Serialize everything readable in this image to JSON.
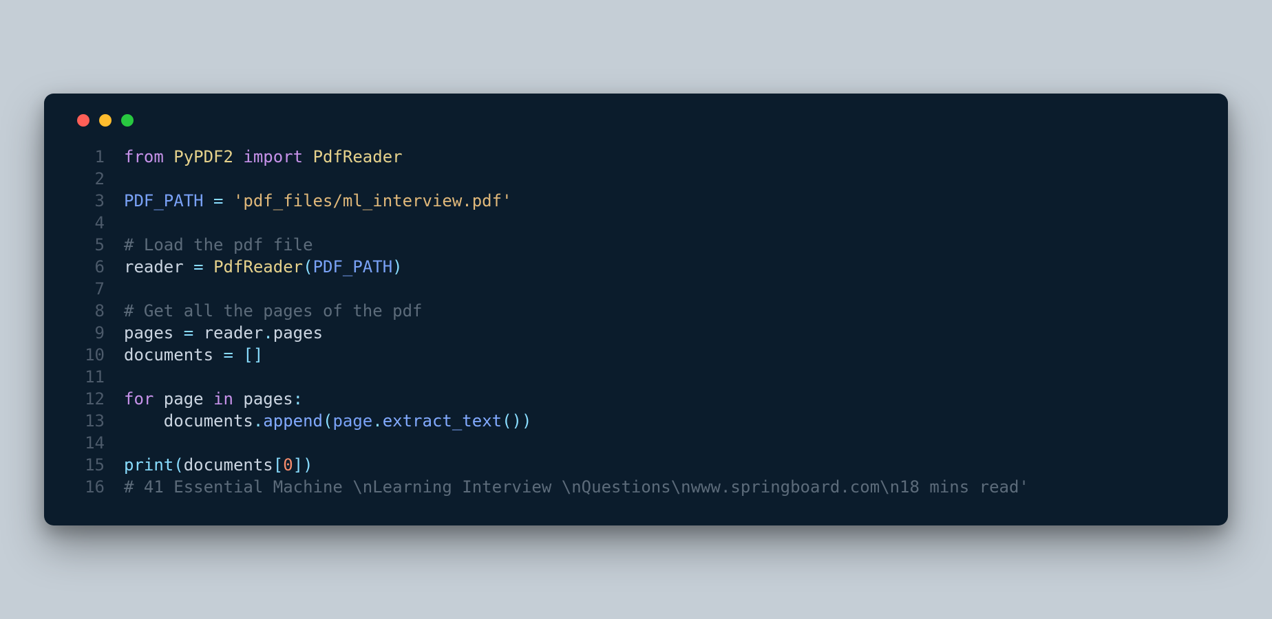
{
  "window": {
    "dots": [
      "red",
      "yellow",
      "green"
    ]
  },
  "code": {
    "lines": [
      {
        "n": "1",
        "tokens": [
          {
            "t": "from ",
            "c": "kw"
          },
          {
            "t": "PyPDF2 ",
            "c": "cls"
          },
          {
            "t": "import ",
            "c": "kw"
          },
          {
            "t": "PdfReader",
            "c": "cls"
          }
        ]
      },
      {
        "n": "2",
        "tokens": []
      },
      {
        "n": "3",
        "tokens": [
          {
            "t": "PDF_PATH ",
            "c": "const"
          },
          {
            "t": "= ",
            "c": "op"
          },
          {
            "t": "'pdf_files/ml_interview.pdf'",
            "c": "str"
          }
        ]
      },
      {
        "n": "4",
        "tokens": []
      },
      {
        "n": "5",
        "tokens": [
          {
            "t": "# Load the pdf file",
            "c": "cmt"
          }
        ]
      },
      {
        "n": "6",
        "tokens": [
          {
            "t": "reader ",
            "c": "var"
          },
          {
            "t": "= ",
            "c": "op"
          },
          {
            "t": "PdfReader",
            "c": "call"
          },
          {
            "t": "(",
            "c": "op"
          },
          {
            "t": "PDF_PATH",
            "c": "const"
          },
          {
            "t": ")",
            "c": "op"
          }
        ]
      },
      {
        "n": "7",
        "tokens": []
      },
      {
        "n": "8",
        "tokens": [
          {
            "t": "# Get all the pages of the pdf",
            "c": "cmt"
          }
        ]
      },
      {
        "n": "9",
        "tokens": [
          {
            "t": "pages ",
            "c": "var"
          },
          {
            "t": "= ",
            "c": "op"
          },
          {
            "t": "reader",
            "c": "var"
          },
          {
            "t": ".",
            "c": "op"
          },
          {
            "t": "pages",
            "c": "var"
          }
        ]
      },
      {
        "n": "10",
        "tokens": [
          {
            "t": "documents ",
            "c": "var"
          },
          {
            "t": "= ",
            "c": "op"
          },
          {
            "t": "[]",
            "c": "op"
          }
        ]
      },
      {
        "n": "11",
        "tokens": []
      },
      {
        "n": "12",
        "tokens": [
          {
            "t": "for ",
            "c": "kw"
          },
          {
            "t": "page ",
            "c": "var"
          },
          {
            "t": "in ",
            "c": "kw"
          },
          {
            "t": "pages",
            "c": "var"
          },
          {
            "t": ":",
            "c": "op"
          }
        ]
      },
      {
        "n": "13",
        "tokens": [
          {
            "t": "    ",
            "c": "var"
          },
          {
            "t": "documents",
            "c": "var"
          },
          {
            "t": ".",
            "c": "op"
          },
          {
            "t": "append",
            "c": "fn"
          },
          {
            "t": "(",
            "c": "op"
          },
          {
            "t": "page",
            "c": "param"
          },
          {
            "t": ".",
            "c": "op"
          },
          {
            "t": "extract_text",
            "c": "fn"
          },
          {
            "t": "())",
            "c": "op"
          }
        ]
      },
      {
        "n": "14",
        "tokens": []
      },
      {
        "n": "15",
        "tokens": [
          {
            "t": "print",
            "c": "builtin"
          },
          {
            "t": "(",
            "c": "op"
          },
          {
            "t": "documents",
            "c": "var"
          },
          {
            "t": "[",
            "c": "op"
          },
          {
            "t": "0",
            "c": "num"
          },
          {
            "t": "])",
            "c": "op"
          }
        ]
      },
      {
        "n": "16",
        "tokens": [
          {
            "t": "# 41 Essential Machine \\nLearning Interview \\nQuestions\\nwww.springboard.com\\n18 mins read'",
            "c": "cmt"
          }
        ]
      }
    ]
  }
}
